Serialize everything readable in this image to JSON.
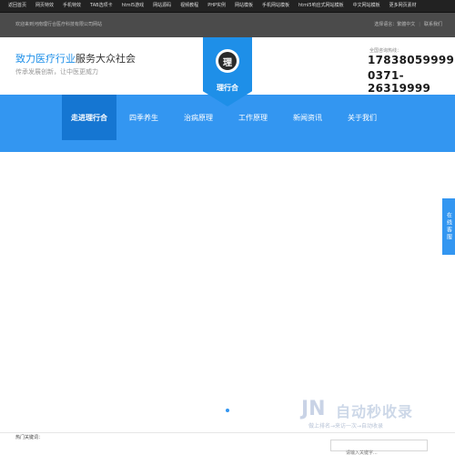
{
  "topbar": {
    "links": [
      "返回首页",
      "网页特效",
      "手机特效",
      "TAB选项卡",
      "html5游戏",
      "网站源码",
      "视频教程",
      "PHP实例",
      "网站模板",
      "手机网站模板",
      "html5响应式网站模板",
      "中文网站模板",
      "更多网页素材"
    ]
  },
  "greybar": {
    "welcome": "欢迎来到河南理行合医疗科技有限公司网站",
    "contact": "选择语言：繁體中文",
    "contact_us": "联系我们"
  },
  "header": {
    "slogan_highlight": "致力医疗行业",
    "slogan_rest": "服务大众社会",
    "sub": "传承发展创新，让中医更威力",
    "logo_mark": "理",
    "logo_text": "理行合",
    "hotline_label": "全国咨询热线：",
    "hotline_1": "17838059999",
    "hotline_2": "0371-26319999"
  },
  "nav": {
    "items": [
      "走进理行合",
      "四季养生",
      "治病原理",
      "工作原理",
      "新闻资讯",
      "关于我们"
    ],
    "active_index": 0
  },
  "service_tab": "在线客服",
  "watermark": {
    "mark": "JN",
    "big": "自动秒收录",
    "small": "做上排名→来访一次→自动收录"
  },
  "footer": {
    "hot_label": "热门关键词：",
    "search_placeholder": "请输入关键字..."
  },
  "colors": {
    "accent": "#3396f1",
    "nav_active": "#1576d2",
    "topbar": "#222222",
    "greybar": "#4b4b4b"
  }
}
